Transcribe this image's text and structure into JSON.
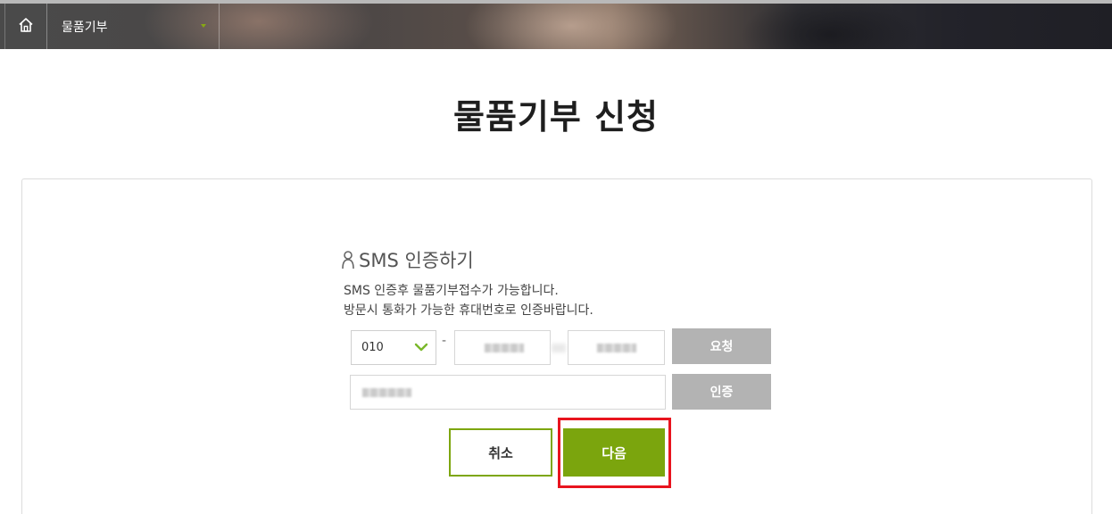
{
  "header": {
    "home_icon": "home-icon",
    "menu_label": "물품기부",
    "menu_caret_color": "#86a814"
  },
  "page": {
    "title": "물품기부 신청"
  },
  "sms": {
    "icon": "person-icon",
    "heading": "SMS 인증하기",
    "desc_line1": "SMS 인증후 물품기부접수가 가능합니다.",
    "desc_line2": "방문시 통화가 가능한 휴대번호로 인증바랍니다.",
    "carrier_prefix": "010",
    "separator": "-",
    "request_button": "요청",
    "verify_button": "인증"
  },
  "actions": {
    "cancel": "취소",
    "next": "다음"
  },
  "colors": {
    "accent": "#7ba50d",
    "gray_button": "#b3b3b3",
    "highlight": "#e8141e"
  }
}
